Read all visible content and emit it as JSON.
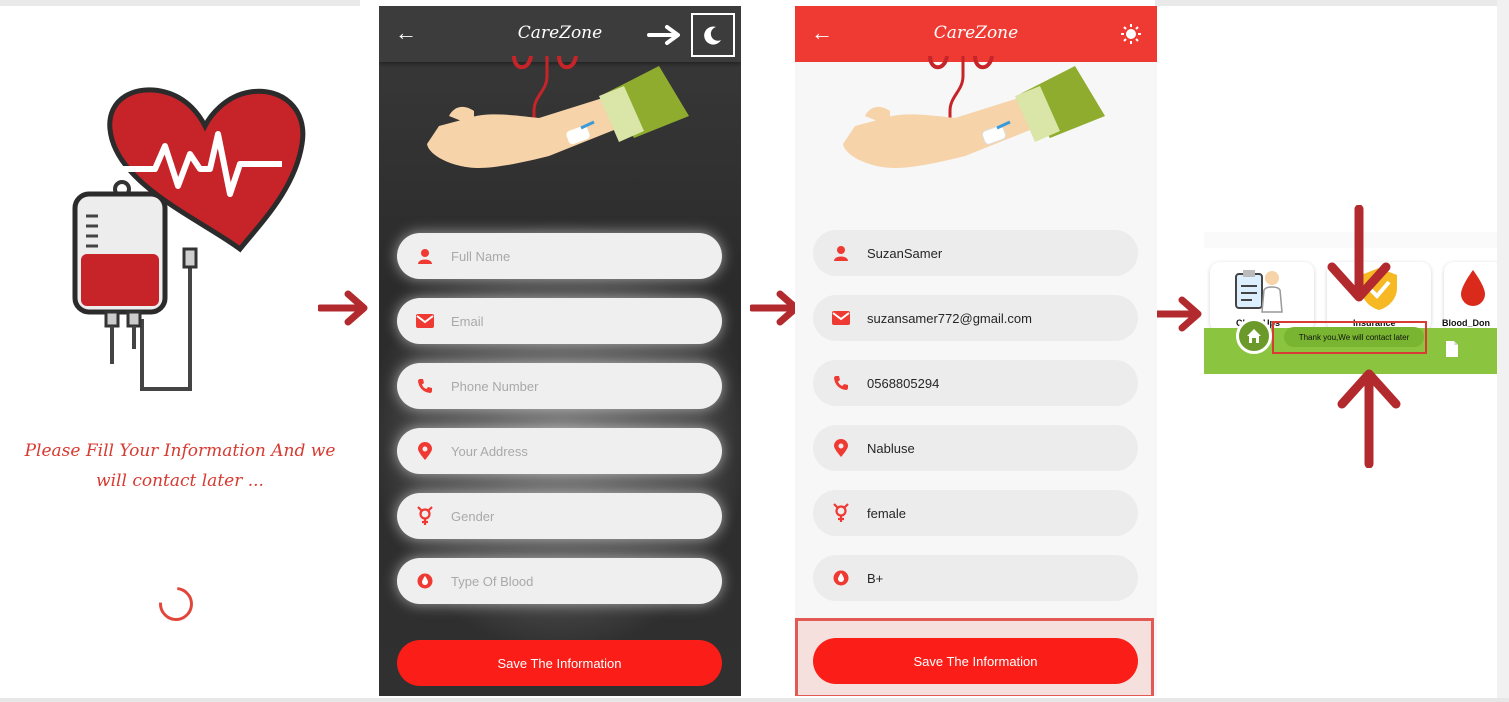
{
  "splash": {
    "message": "Please Fill Your Information And we will contact later ..."
  },
  "app": {
    "title": "CareZone",
    "back_icon": "arrow-left-icon",
    "theme_icon_dark": "moon-icon",
    "theme_icon_light": "sun-icon"
  },
  "form_empty": {
    "fields": [
      {
        "icon": "person-icon",
        "placeholder": "Full Name"
      },
      {
        "icon": "email-icon",
        "placeholder": "Email"
      },
      {
        "icon": "phone-icon",
        "placeholder": "Phone Number"
      },
      {
        "icon": "location-pin-icon",
        "placeholder": "Your Address"
      },
      {
        "icon": "gender-icon",
        "placeholder": "Gender"
      },
      {
        "icon": "blood-drop-icon",
        "placeholder": "Type Of Blood"
      }
    ],
    "save_label": "Save The Information"
  },
  "form_filled": {
    "fields": [
      {
        "icon": "person-icon",
        "value": "SuzanSamer"
      },
      {
        "icon": "email-icon",
        "value": "suzansamer772@gmail.com"
      },
      {
        "icon": "phone-icon",
        "value": "0568805294"
      },
      {
        "icon": "location-pin-icon",
        "value": "Nabluse"
      },
      {
        "icon": "gender-icon",
        "value": "female"
      },
      {
        "icon": "blood-drop-icon",
        "value": "B+"
      }
    ],
    "save_label": "Save The Information"
  },
  "home": {
    "cards": [
      {
        "label": "CheckUps",
        "icon": "clipboard-doctor-icon"
      },
      {
        "label": "Insurance",
        "icon": "shield-check-icon"
      },
      {
        "label": "Blood_Don",
        "icon": "blood-drop-icon"
      }
    ],
    "toast": "Thank you,We will contact later",
    "nav_icons": [
      "home-icon",
      "document-icon"
    ]
  },
  "colors": {
    "brand_red": "#ef3a33",
    "button_red": "#fb1d17",
    "arrow_red": "#b22a2e",
    "nav_green": "#8bc53f"
  }
}
